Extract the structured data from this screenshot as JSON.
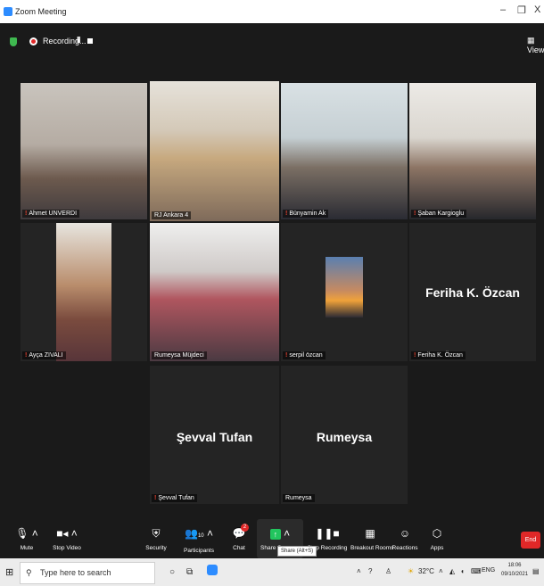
{
  "window": {
    "title": "Zoom Meeting",
    "minimize_glyph": "–",
    "restore_glyph": "❐",
    "close_glyph": "X"
  },
  "topbar": {
    "recording_label": "Recording...",
    "pause_glyph": "II",
    "view_label": "View",
    "view_icon": "▦"
  },
  "participants": [
    {
      "name": "Ahmet UNVERDI",
      "muted": true
    },
    {
      "name": "RJ Ankara 4",
      "muted": false,
      "active_speaker": true
    },
    {
      "name": "Bünyamin Ak",
      "muted": true
    },
    {
      "name": "Şaban Kargioglu",
      "muted": true
    },
    {
      "name": "Ayça ZIVALI",
      "muted": true
    },
    {
      "name": "Rumeysa Müjdeci",
      "muted": false
    },
    {
      "name": "serpil özcan",
      "muted": true
    },
    {
      "name": "Feriha K. Özcan",
      "muted": true,
      "display_name": "Feriha K. Özcan"
    },
    {
      "name": "Şevval Tufan",
      "muted": true,
      "display_name": "Şevval Tufan"
    },
    {
      "name": "Rumeysa",
      "muted": false,
      "display_name": "Rumeysa"
    }
  ],
  "toolbar": {
    "mute": "Mute",
    "stop_video": "Stop Video",
    "security": "Security",
    "participants": "Participants",
    "participants_count": "10",
    "chat": "Chat",
    "chat_badge": "2",
    "share_screen": "Share Screen",
    "share_tooltip": "Share (Alt+S)",
    "stop_recording": "Stop Recording",
    "breakout_rooms": "Breakout Rooms",
    "reactions": "Reactions",
    "apps": "Apps",
    "end": "End"
  },
  "taskbar": {
    "search_placeholder": "Type here to search",
    "weather": "32°C",
    "language": "ENG",
    "time": "18:06",
    "date": "09/10/2021"
  },
  "colors": {
    "active_speaker_border": "#c8e65a",
    "end_button": "#e02828",
    "recording_dot": "#e02828",
    "share_green": "#22c55e",
    "muted_mic": "#e5412f"
  }
}
